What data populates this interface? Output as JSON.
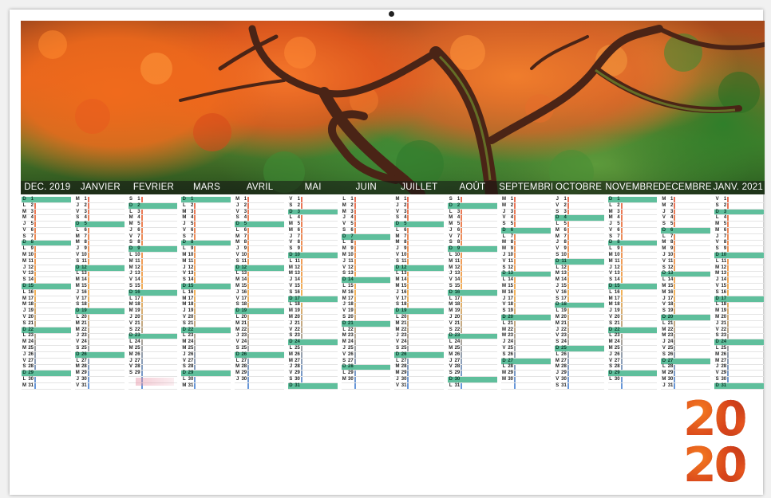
{
  "months": [
    "DEC. 2019",
    "JANVIER",
    "FEVRIER",
    "MARS",
    "AVRIL",
    "MAI",
    "JUIN",
    "JUILLET",
    "AOÛT",
    "SEPTEMBRE",
    "OCTOBRE",
    "NOVEMBRE",
    "DECEMBRE",
    "JANV. 2021"
  ],
  "year": [
    "20",
    "20"
  ],
  "colors": {
    "weekend_band": "#5fbf9c",
    "accent_orange": "#e05a1a",
    "header_overlay": "#141414"
  },
  "icons": {
    "photo": "autumn-maple-tree-photo",
    "year_art": "autumn-leaf-textured-2020"
  }
}
